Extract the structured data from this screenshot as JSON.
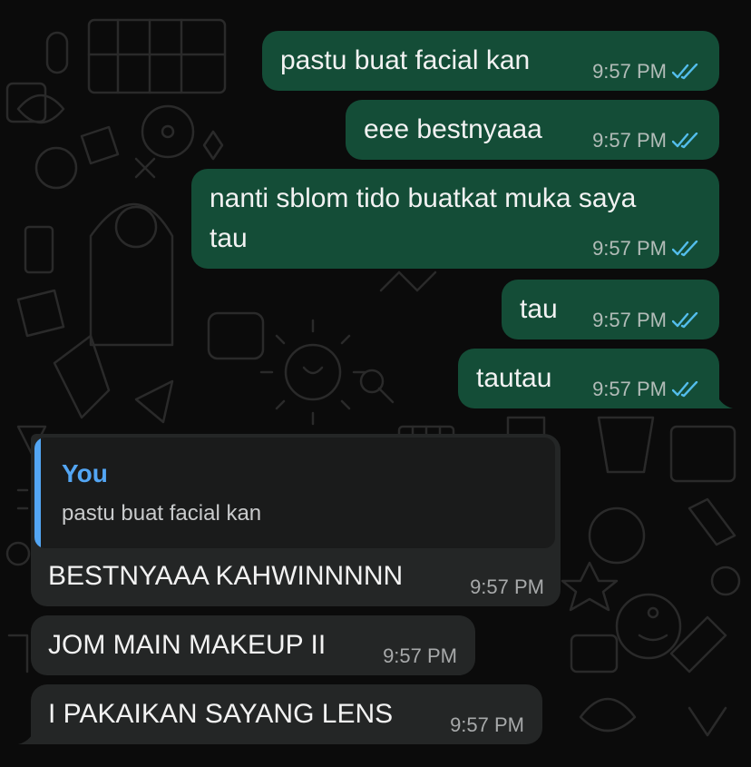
{
  "colors": {
    "outgoing_bubble": "#144d37",
    "incoming_bubble": "#242626",
    "read_receipt": "#53bdeb",
    "quote_accent": "#53a6f4",
    "background": "#0b0b0b"
  },
  "icons": {
    "read_receipt": "double-check-icon"
  },
  "messages": {
    "out": [
      {
        "text": "pastu buat facial kan",
        "time": "9:57 PM"
      },
      {
        "text": "eee bestnyaaa",
        "time": "9:57 PM"
      },
      {
        "text_line1": "nanti sblom tido buatkat muka saya",
        "text_line2": "tau",
        "time": "9:57 PM"
      },
      {
        "text": "tau",
        "time": "9:57 PM"
      },
      {
        "text": "tautau",
        "time": "9:57 PM"
      }
    ],
    "in": [
      {
        "quote_author": "You",
        "quote_text": "pastu buat facial kan",
        "text": "BESTNYAAA KAHWINNNNN",
        "time": "9:57 PM"
      },
      {
        "text": "JOM MAIN MAKEUP II",
        "time": "9:57 PM"
      },
      {
        "text": "I PAKAIKAN SAYANG LENS",
        "time": "9:57 PM"
      }
    ]
  }
}
